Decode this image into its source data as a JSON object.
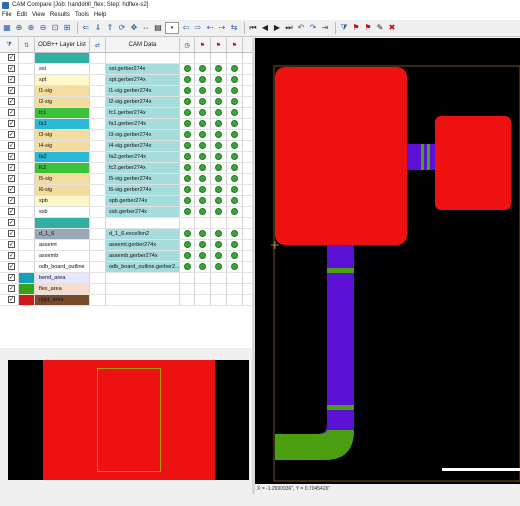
{
  "window": {
    "title": "CAM Compare [Job: handdrill_flex; Step: hdflex-s2]"
  },
  "menu": [
    "File",
    "Edit",
    "View",
    "Results",
    "Tools",
    "Help"
  ],
  "columns": {
    "layer_list": "ODB++ Layer List",
    "cam_data": "CAM Data"
  },
  "colors": {
    "accent": "#2a5fa8",
    "cam_bg": "#a6dcdc",
    "dot_green": "#3aa63a",
    "canvas_bg": "#000000",
    "red_shape": "#ee1111",
    "purple_trace": "#5b10d6",
    "green_shape": "#4aa010"
  },
  "rows": [
    {
      "layer": "",
      "color": "#2fb0a0",
      "cam": "",
      "dots": false,
      "checked": true
    },
    {
      "layer": "sst",
      "color": "#ffffff",
      "cam": "sst.gerber274x",
      "dots": true,
      "checked": true
    },
    {
      "layer": "spt",
      "color": "#fff7c8",
      "cam": "spt.gerber274x",
      "dots": true,
      "checked": true
    },
    {
      "layer": "l1-sig",
      "color": "#f3dca0",
      "cam": "l1-sig.gerber274x",
      "dots": true,
      "checked": true
    },
    {
      "layer": "l2-sig",
      "color": "#f3dca0",
      "cam": "l2-sig.gerber274x",
      "dots": true,
      "checked": true
    },
    {
      "layer": "fc1",
      "color": "#3bc23b",
      "cam": "fc1.gerber274x",
      "dots": true,
      "checked": true
    },
    {
      "layer": "fa1",
      "color": "#2ab8d6",
      "cam": "fa1.gerber274x",
      "dots": true,
      "checked": true
    },
    {
      "layer": "l3-sig",
      "color": "#f3dca0",
      "cam": "l3-sig.gerber274x",
      "dots": true,
      "checked": true
    },
    {
      "layer": "l4-sig",
      "color": "#f3dca0",
      "cam": "l4-sig.gerber274x",
      "dots": true,
      "checked": true
    },
    {
      "layer": "fa2",
      "color": "#2ab8d6",
      "cam": "fa2.gerber274x",
      "dots": true,
      "checked": true
    },
    {
      "layer": "fc2",
      "color": "#3bc23b",
      "cam": "fc2.gerber274x",
      "dots": true,
      "checked": true
    },
    {
      "layer": "l5-sig",
      "color": "#f3dca0",
      "cam": "l5-sig.gerber274x",
      "dots": true,
      "checked": true
    },
    {
      "layer": "l6-sig",
      "color": "#f3dca0",
      "cam": "l6-sig.gerber274x",
      "dots": true,
      "checked": true
    },
    {
      "layer": "spb",
      "color": "#fff7c8",
      "cam": "spb.gerber274x",
      "dots": true,
      "checked": true
    },
    {
      "layer": "ssb",
      "color": "#ffffff",
      "cam": "ssb.gerber274x",
      "dots": true,
      "checked": true
    },
    {
      "layer": "",
      "color": "#2fb0a0",
      "cam": "",
      "dots": false,
      "checked": true
    },
    {
      "layer": "d_1_6",
      "color": "#9aa8b8",
      "cam": "d_1_6.excellon2",
      "dots": true,
      "checked": true
    },
    {
      "layer": "assemt",
      "color": "#ffffff",
      "cam": "assemt.gerber274x",
      "dots": true,
      "checked": true
    },
    {
      "layer": "assemb",
      "color": "#ffffff",
      "cam": "assemb.gerber274x",
      "dots": true,
      "checked": true
    },
    {
      "layer": "odb_board_outline",
      "color": "#ffffff",
      "cam": "odb_board_outline.gerber2...",
      "dots": true,
      "checked": true
    },
    {
      "layer": "bend_area",
      "color": "#e6e6ff",
      "cam": "",
      "dots": false,
      "checked": true,
      "swatch": "#15a0b8"
    },
    {
      "layer": "flex_area",
      "color": "#f6dccc",
      "cam": "",
      "dots": false,
      "checked": true,
      "swatch": "#3aa018"
    },
    {
      "layer": "rigid_area",
      "color": "#7a4a2a",
      "cam": "",
      "dots": false,
      "checked": true,
      "swatch": "#d01818"
    }
  ],
  "statusbar": {
    "coords": "X = -1.2690936\", Y = 0.7045426\""
  }
}
